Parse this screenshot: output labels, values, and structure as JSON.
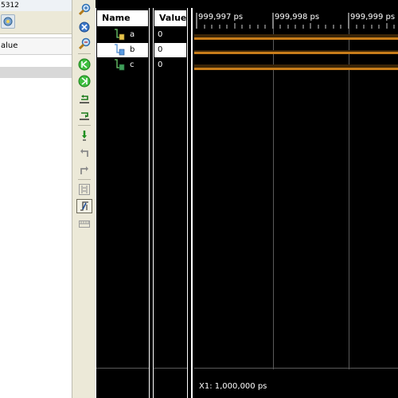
{
  "left": {
    "title": "5312",
    "column_header": "alue"
  },
  "toolbar": {
    "buttons": [
      {
        "name": "zoom-in-icon"
      },
      {
        "name": "zoom-fit-icon"
      },
      {
        "name": "zoom-out-icon"
      },
      {
        "name": "go-to-start-icon"
      },
      {
        "name": "go-to-end-icon"
      },
      {
        "name": "previous-transition-icon"
      },
      {
        "name": "next-transition-icon"
      },
      {
        "name": "add-marker-icon"
      },
      {
        "name": "previous-marker-icon"
      },
      {
        "name": "next-marker-icon"
      },
      {
        "name": "swap-cursors-icon"
      },
      {
        "name": "snap-to-transition-icon"
      },
      {
        "name": "floating-ruler-icon"
      }
    ]
  },
  "name_panel": {
    "header": "Name"
  },
  "value_panel": {
    "header": "Value"
  },
  "signals": [
    {
      "name": "a",
      "value": "0"
    },
    {
      "name": "b",
      "value": "0"
    },
    {
      "name": "c",
      "value": "0"
    }
  ],
  "wave": {
    "ticks": [
      "999,997 ps",
      "999,998 ps",
      "999,999 ps"
    ],
    "cursor_readout": "X1: 1,000,000 ps",
    "trace_color": "#c87d1a"
  }
}
